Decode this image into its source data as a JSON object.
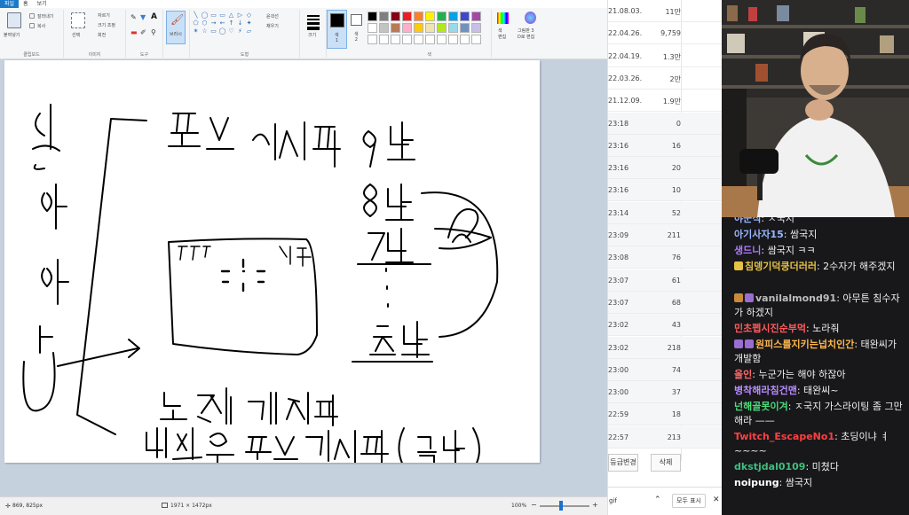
{
  "paint": {
    "menu_tabs": [
      "파일",
      "홈",
      "보기"
    ],
    "clipboard": {
      "paste": "붙여넣기",
      "cut": "잘라내기",
      "copy": "복사",
      "label": "클립보드"
    },
    "image": {
      "select": "선택",
      "crop": "자르기",
      "resize": "크기 조정",
      "rotate": "회전",
      "label": "이미지"
    },
    "tools": {
      "label": "도구"
    },
    "brushes": {
      "label": "브러시"
    },
    "shapes": {
      "outline": "윤곽선",
      "fill": "채우기",
      "label": "도형",
      "glyphs": [
        "╲",
        "◯",
        "▭",
        "▭",
        "△",
        "▷",
        "◇",
        "⬠",
        "⬡",
        "→",
        "←",
        "↑",
        "↓",
        "✦",
        "✶",
        "☆",
        "▭",
        "◯",
        "♡",
        "⚡",
        "▱"
      ]
    },
    "size": {
      "label": "크기"
    },
    "color1": {
      "label": "색\n1"
    },
    "color2": {
      "label": "색\n2"
    },
    "colors": {
      "label": "색",
      "edit": "색\n편집",
      "paint3d": "그림판 3\nD로 편집"
    },
    "swatches": [
      "#000000",
      "#7f7f7f",
      "#880015",
      "#ed1c24",
      "#ff7f27",
      "#fff200",
      "#22b14c",
      "#00a2e8",
      "#3f48cc",
      "#a349a4",
      "#ffffff",
      "#c3c3c3",
      "#b97a57",
      "#ffaec9",
      "#ffc90e",
      "#efe4b0",
      "#b5e61d",
      "#99d9ea",
      "#7092be",
      "#c8bfe7",
      "#ffffff",
      "#ffffff",
      "#ffffff",
      "#ffffff",
      "#ffffff",
      "#ffffff",
      "#ffffff",
      "#ffffff",
      "#ffffff",
      "#ffffff"
    ],
    "status": {
      "cursor": "869, 825px",
      "dimensions": "1971 × 1472px",
      "zoom": "100%"
    }
  },
  "list": {
    "rows": [
      {
        "date": "21.08.03.",
        "count": "11만"
      },
      {
        "date": "22.04.26.",
        "count": "9,759"
      },
      {
        "date": "22.04.19.",
        "count": "1.3만"
      },
      {
        "date": "22.03.26.",
        "count": "2만"
      },
      {
        "date": "21.12.09.",
        "count": "1.9만"
      },
      {
        "date": "23:18",
        "count": "0"
      },
      {
        "date": "23:16",
        "count": "16"
      },
      {
        "date": "23:16",
        "count": "20"
      },
      {
        "date": "23:16",
        "count": "10"
      },
      {
        "date": "23:14",
        "count": "52"
      },
      {
        "date": "23:09",
        "count": "211"
      },
      {
        "date": "23:08",
        "count": "76"
      },
      {
        "date": "23:07",
        "count": "61"
      },
      {
        "date": "23:07",
        "count": "68"
      },
      {
        "date": "23:02",
        "count": "43"
      },
      {
        "date": "23:02",
        "count": "218"
      },
      {
        "date": "23:00",
        "count": "74"
      },
      {
        "date": "23:00",
        "count": "37"
      },
      {
        "date": "22:59",
        "count": "18"
      },
      {
        "date": "22:57",
        "count": "213"
      }
    ],
    "grade_btn": "등급변경",
    "delete_btn": "삭제",
    "bottom_text": "gif",
    "view_all": "모두 표시"
  },
  "chat": {
    "messages": [
      {
        "nick": "야군식",
        "text": ": ㅈ국지",
        "color": "#9ab7ff"
      },
      {
        "nick": "아기사자15",
        "text": ": 쌈국지",
        "color": "#9ab7ff"
      },
      {
        "nick": "생드니",
        "text": ": 쌈국지 ㅋㅋ",
        "color": "#b07cff"
      },
      {
        "nick": "침뎅기덕쿵더러러",
        "text": ": 2수자가 해주겠지",
        "color": "#e6c244"
      },
      {
        "nick": "vanilalmond91",
        "text": ": 아무튼 침수자가 하겠지",
        "color": "#bdbdbd"
      },
      {
        "nick": "민초펩시진순부먹",
        "text": ": 노라줘",
        "color": "#ff5a5a"
      },
      {
        "nick": "원피스를지키는넙치인간",
        "text": ": 태완씨가 개발함",
        "color": "#ffb74d"
      },
      {
        "nick": "올인",
        "text": ": 누군가는 해야 하잖아",
        "color": "#ff6b6b"
      },
      {
        "nick": "병착해라침건맨",
        "text": ": 태완씨~",
        "color": "#b98cff"
      },
      {
        "nick": "넌해골못이겨",
        "text": ": ㅈ국지 가스라이팅 좀 그만해라 ——",
        "color": "#4ddc7a"
      },
      {
        "nick": "Twitch_EscapeNo1",
        "text": ": 초딩이냐 ㅕ ~~~~",
        "color": "#ff4040"
      },
      {
        "nick": "dkstjdal0109",
        "text": ": 미쳤다",
        "color": "#3fbf7f"
      },
      {
        "nick": "noipung",
        "text": ": 쌈국지",
        "color": "#ffffff"
      }
    ]
  }
}
